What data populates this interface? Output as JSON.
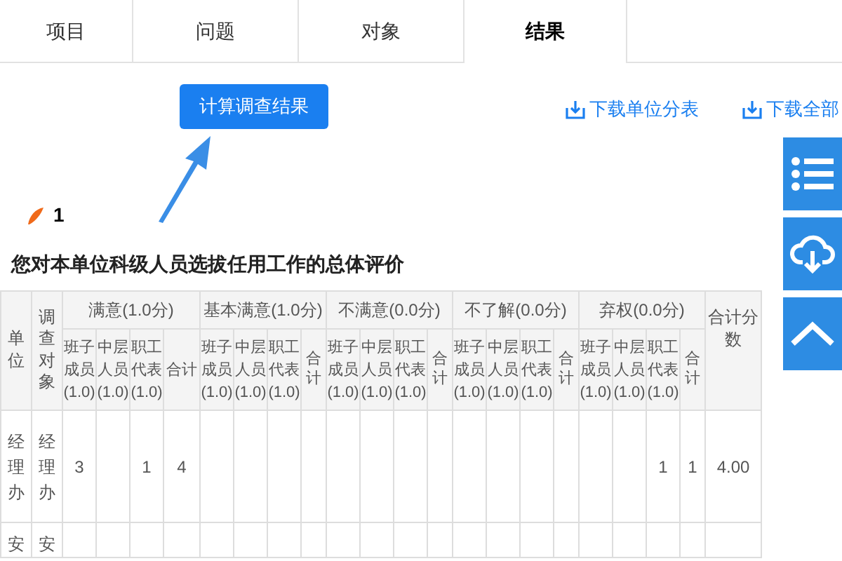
{
  "tabs": [
    {
      "label": "项目",
      "selected": false
    },
    {
      "label": "问题",
      "selected": false
    },
    {
      "label": "对象",
      "selected": false
    },
    {
      "label": "结果",
      "selected": true
    }
  ],
  "calc_button": "计算调查结果",
  "downloads": [
    "下载单位分表",
    "下载全部"
  ],
  "marker": "1",
  "question": "您对本单位科级人员选拔任用工作的总体评价",
  "table": {
    "unit_header": "单位",
    "target_header": "调查对象",
    "total_header": "合计分数",
    "groups": [
      {
        "label": "满意(1.0分)",
        "subs": [
          "班子成员(1.0)",
          "中层人员(1.0)",
          "职工代表(1.0)",
          "合计"
        ]
      },
      {
        "label": "基本满意(1.0分)",
        "subs": [
          "班子成员(1.0)",
          "中层人员(1.0)",
          "职工代表(1.0)",
          "合计"
        ]
      },
      {
        "label": "不满意(0.0分)",
        "subs": [
          "班子成员(1.0)",
          "中层人员(1.0)",
          "职工代表(1.0)",
          "合计"
        ]
      },
      {
        "label": "不了解(0.0分)",
        "subs": [
          "班子成员(1.0)",
          "中层人员(1.0)",
          "职工代表(1.0)",
          "合计"
        ]
      },
      {
        "label": "弃权(0.0分)",
        "subs": [
          "班子成员(1.0)",
          "中层人员(1.0)",
          "职工代表(1.0)",
          "合计"
        ]
      }
    ],
    "rows": [
      {
        "unit": "经理办",
        "target": "经理办",
        "cells": [
          "3",
          "",
          "1",
          "4",
          "",
          "",
          "",
          "",
          "",
          "",
          "",
          "",
          "",
          "",
          "",
          "",
          "",
          "",
          "1",
          "1"
        ],
        "total": "4.00"
      },
      {
        "unit": "安",
        "target": "安",
        "cells": [],
        "total": ""
      }
    ]
  }
}
